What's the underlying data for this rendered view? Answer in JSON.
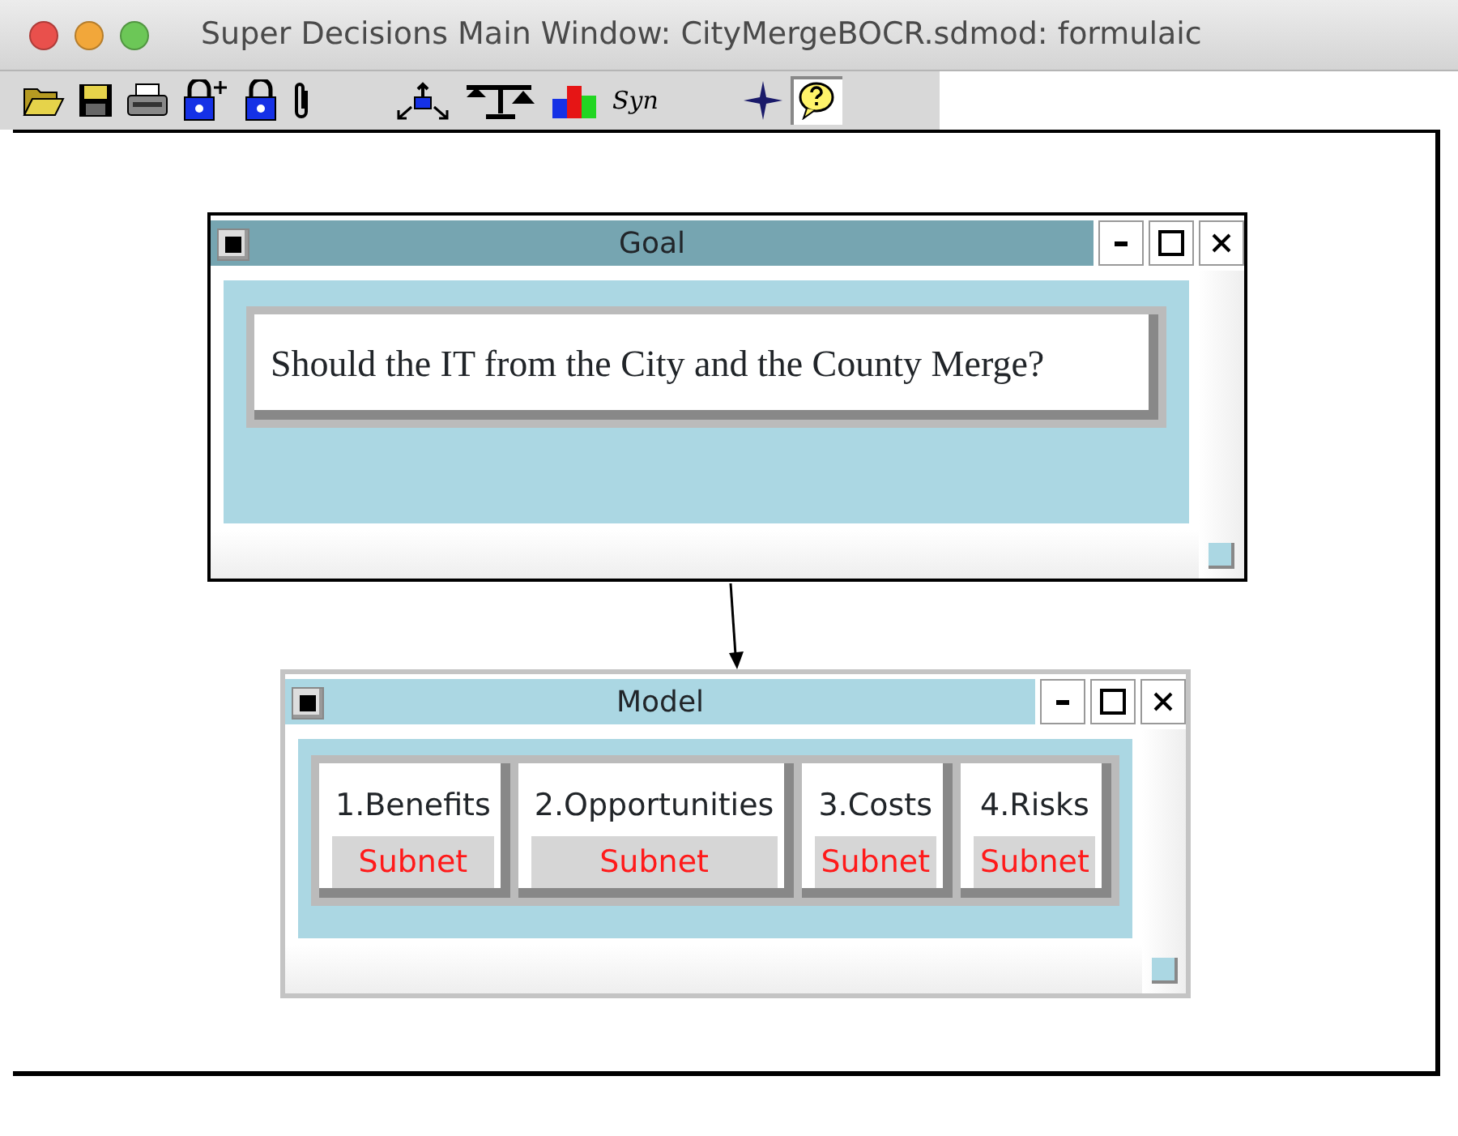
{
  "window": {
    "title": "Super Decisions Main Window: CityMergeBOCR.sdmod: formulaic"
  },
  "toolbar": [
    {
      "kind": "open"
    },
    {
      "kind": "save"
    },
    {
      "kind": "print"
    },
    {
      "kind": "lock-plus"
    },
    {
      "kind": "lock"
    },
    {
      "kind": "clip"
    },
    {
      "kind": "gap"
    },
    {
      "kind": "network"
    },
    {
      "kind": "scale"
    },
    {
      "kind": "bars"
    },
    {
      "kind": "text",
      "text": "Syn"
    },
    {
      "kind": "gap"
    },
    {
      "kind": "compass"
    },
    {
      "kind": "help",
      "pressed": true
    }
  ],
  "clusters": [
    {
      "title": "Goal",
      "active": true,
      "nodes": [
        {
          "kind": "text",
          "label": "Should the IT from the City and the County Merge?"
        }
      ]
    },
    {
      "title": "Model",
      "active": false,
      "nodes": [
        {
          "kind": "subnet",
          "label": "1.Benefits",
          "sublabel": "Subnet"
        },
        {
          "kind": "subnet",
          "label": "2.Opportunities",
          "sublabel": "Subnet"
        },
        {
          "kind": "subnet",
          "label": "3.Costs",
          "sublabel": "Subnet"
        },
        {
          "kind": "subnet",
          "label": "4.Risks",
          "sublabel": "Subnet"
        }
      ]
    }
  ]
}
